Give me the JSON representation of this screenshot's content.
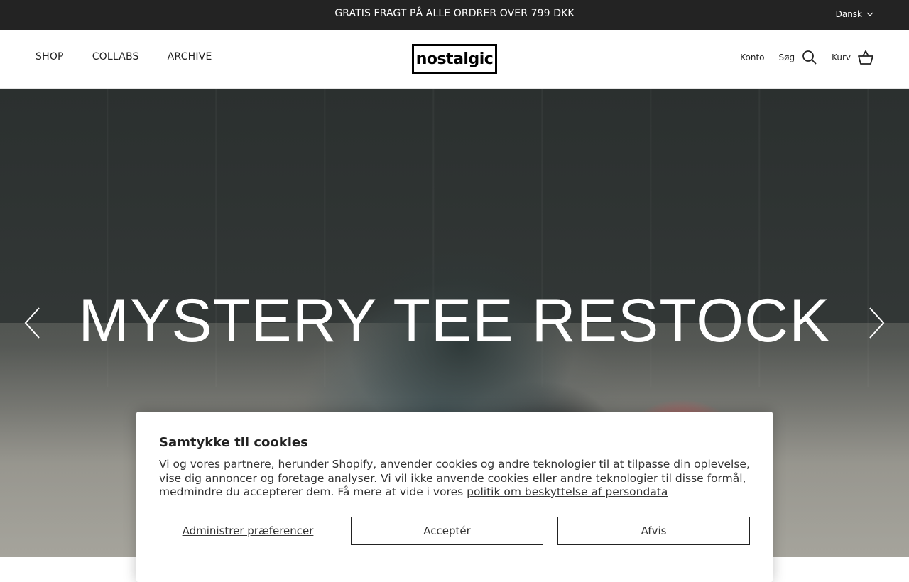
{
  "announcement": {
    "text": "GRATIS FRAGT PÅ ALLE ORDRER OVER 799 DKK"
  },
  "language": {
    "label": "Dansk"
  },
  "nav": {
    "items": [
      {
        "label": "SHOP"
      },
      {
        "label": "COLLABS"
      },
      {
        "label": "ARCHIVE"
      }
    ]
  },
  "logo": {
    "text": "nostalgic"
  },
  "header_right": {
    "account": "Konto",
    "search": "Søg",
    "cart": "Kurv"
  },
  "hero": {
    "title": "MYSTERY TEE RESTOCK"
  },
  "cookie": {
    "title": "Samtykke til cookies",
    "text": "Vi og vores partnere, herunder Shopify, anvender cookies og andre teknologier til at tilpasse din oplevelse, vise dig annoncer og foretage analyser. Vi vil ikke anvende cookies eller andre teknologier til disse formål, medmindre du accepterer dem. Få mere at vide i vores ",
    "link": "politik om beskyttelse af persondata",
    "manage": "Administrer præferencer",
    "accept": "Acceptér",
    "decline": "Afvis"
  },
  "icons": {
    "chevron": "chevron-down-icon",
    "search": "search-icon",
    "cart": "basket-icon",
    "prev": "chevron-left-icon",
    "next": "chevron-right-icon"
  }
}
